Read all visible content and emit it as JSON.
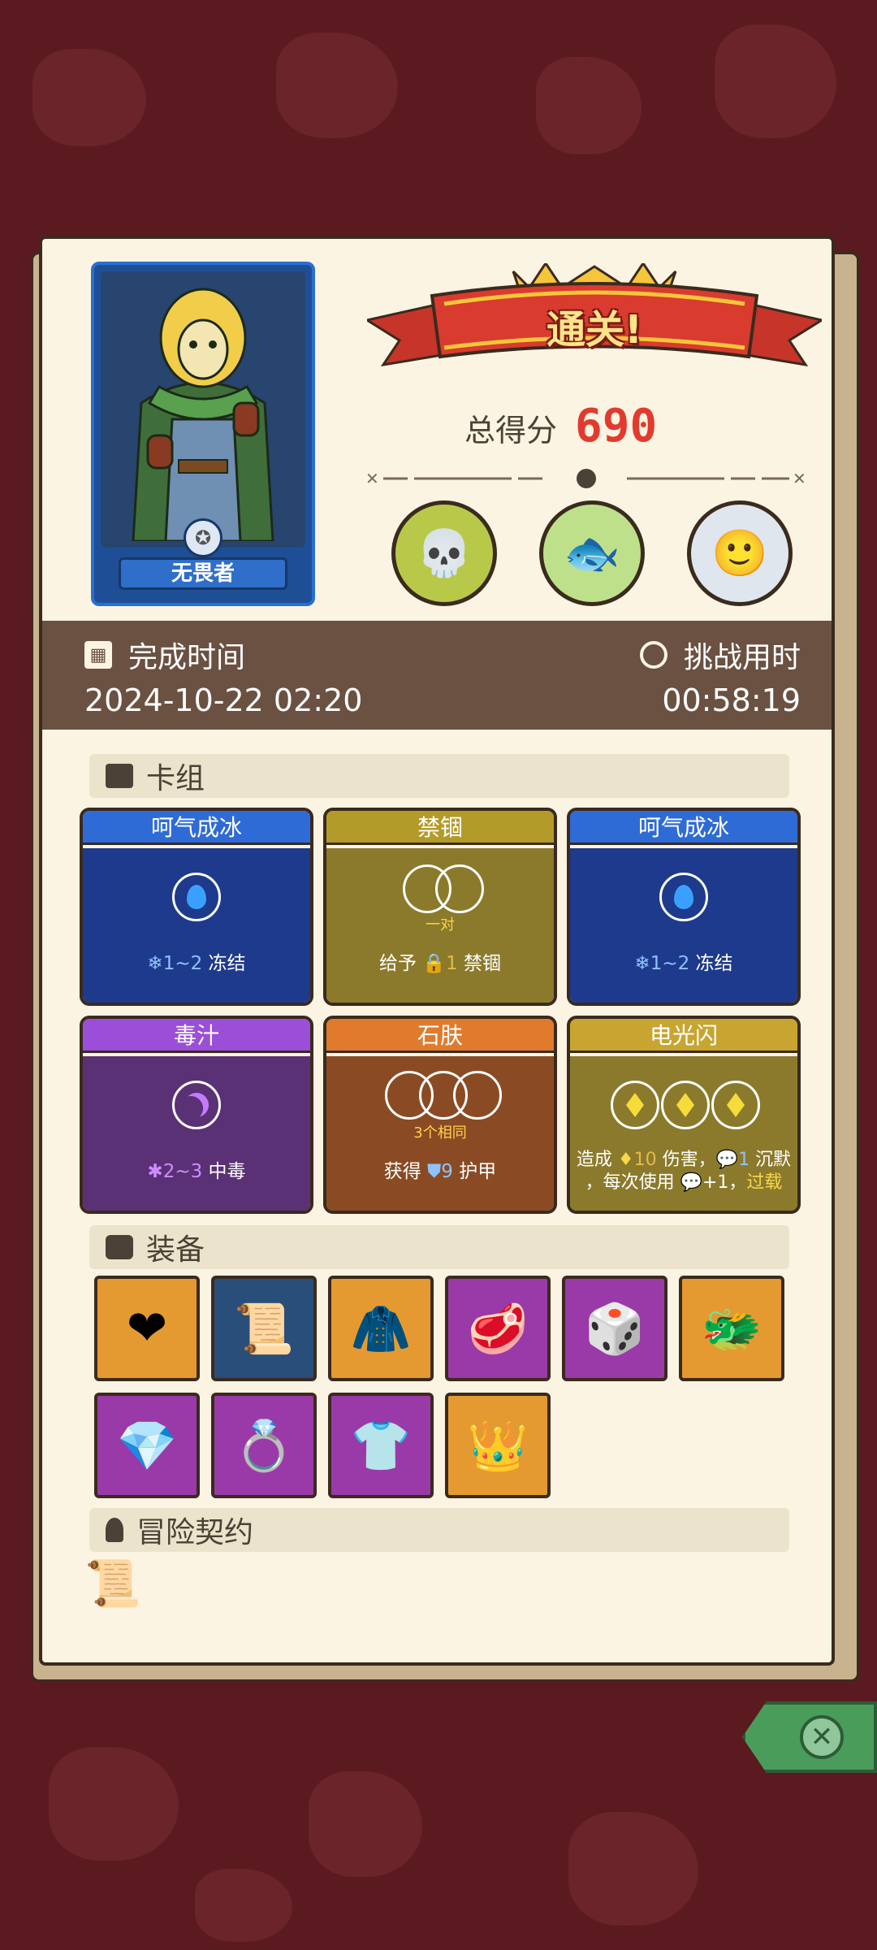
{
  "result": {
    "banner_text": "通关!",
    "score_label": "总得分",
    "score_value": "690"
  },
  "hero": {
    "name": "无畏者"
  },
  "time": {
    "finish_label": "完成时间",
    "finish_value": "2024-10-22 02:20",
    "duration_label": "挑战用时",
    "duration_value": "00:58:19"
  },
  "sections": {
    "deck": "卡组",
    "equipment": "装备",
    "contract": "冒险契约"
  },
  "cards": [
    {
      "title": "呵气成冰",
      "theme": "blue",
      "icon": "water-drop-icon",
      "desc_a": "1~2",
      "desc_b": " 冻结"
    },
    {
      "title": "禁锢",
      "theme": "olive",
      "icon": "two-slots",
      "slot_note": "一对",
      "desc_a": "给予 ",
      "desc_b": "1",
      "desc_c": " 禁锢"
    },
    {
      "title": "呵气成冰",
      "theme": "blue",
      "icon": "water-drop-icon",
      "desc_a": "1~2",
      "desc_b": " 冻结"
    },
    {
      "title": "毒汁",
      "theme": "purple",
      "icon": "moon-icon",
      "desc_a": "2~3",
      "desc_b": " 中毒"
    },
    {
      "title": "石肤",
      "theme": "orange",
      "icon": "three-slots",
      "slot_note": "3个相同",
      "desc_a": "获得 ",
      "desc_b": "9",
      "desc_c": " 护甲"
    },
    {
      "title": "电光闪",
      "theme": "gold",
      "icon": "diamond-icon",
      "line1_a": "造成 ",
      "line1_b": "10",
      "line1_c": " 伤害，",
      "line1_d": "1",
      "line1_e": " 沉默",
      "line2_a": "，每次使用 ",
      "line2_b": "+1，",
      "line2_c": "过载"
    }
  ],
  "equipment": [
    {
      "name": "heart-icon",
      "color": "orange"
    },
    {
      "name": "scroll-icon",
      "color": "blue"
    },
    {
      "name": "sweater-icon",
      "color": "orange"
    },
    {
      "name": "meat-icon",
      "color": "purple"
    },
    {
      "name": "d20-die-icon",
      "color": "purple"
    },
    {
      "name": "dragon-head-icon",
      "color": "orange"
    },
    {
      "name": "ruby-icon",
      "color": "purple"
    },
    {
      "name": "ring-icon",
      "color": "purple"
    },
    {
      "name": "tunic-icon",
      "color": "purple"
    },
    {
      "name": "crown-icon",
      "color": "orange"
    }
  ],
  "colors": {
    "background": "#5a1a20",
    "paper": "#fbf4e2",
    "score_red": "#e23a2f",
    "time_band": "#6b5142",
    "close_green": "#4a9c5a"
  }
}
